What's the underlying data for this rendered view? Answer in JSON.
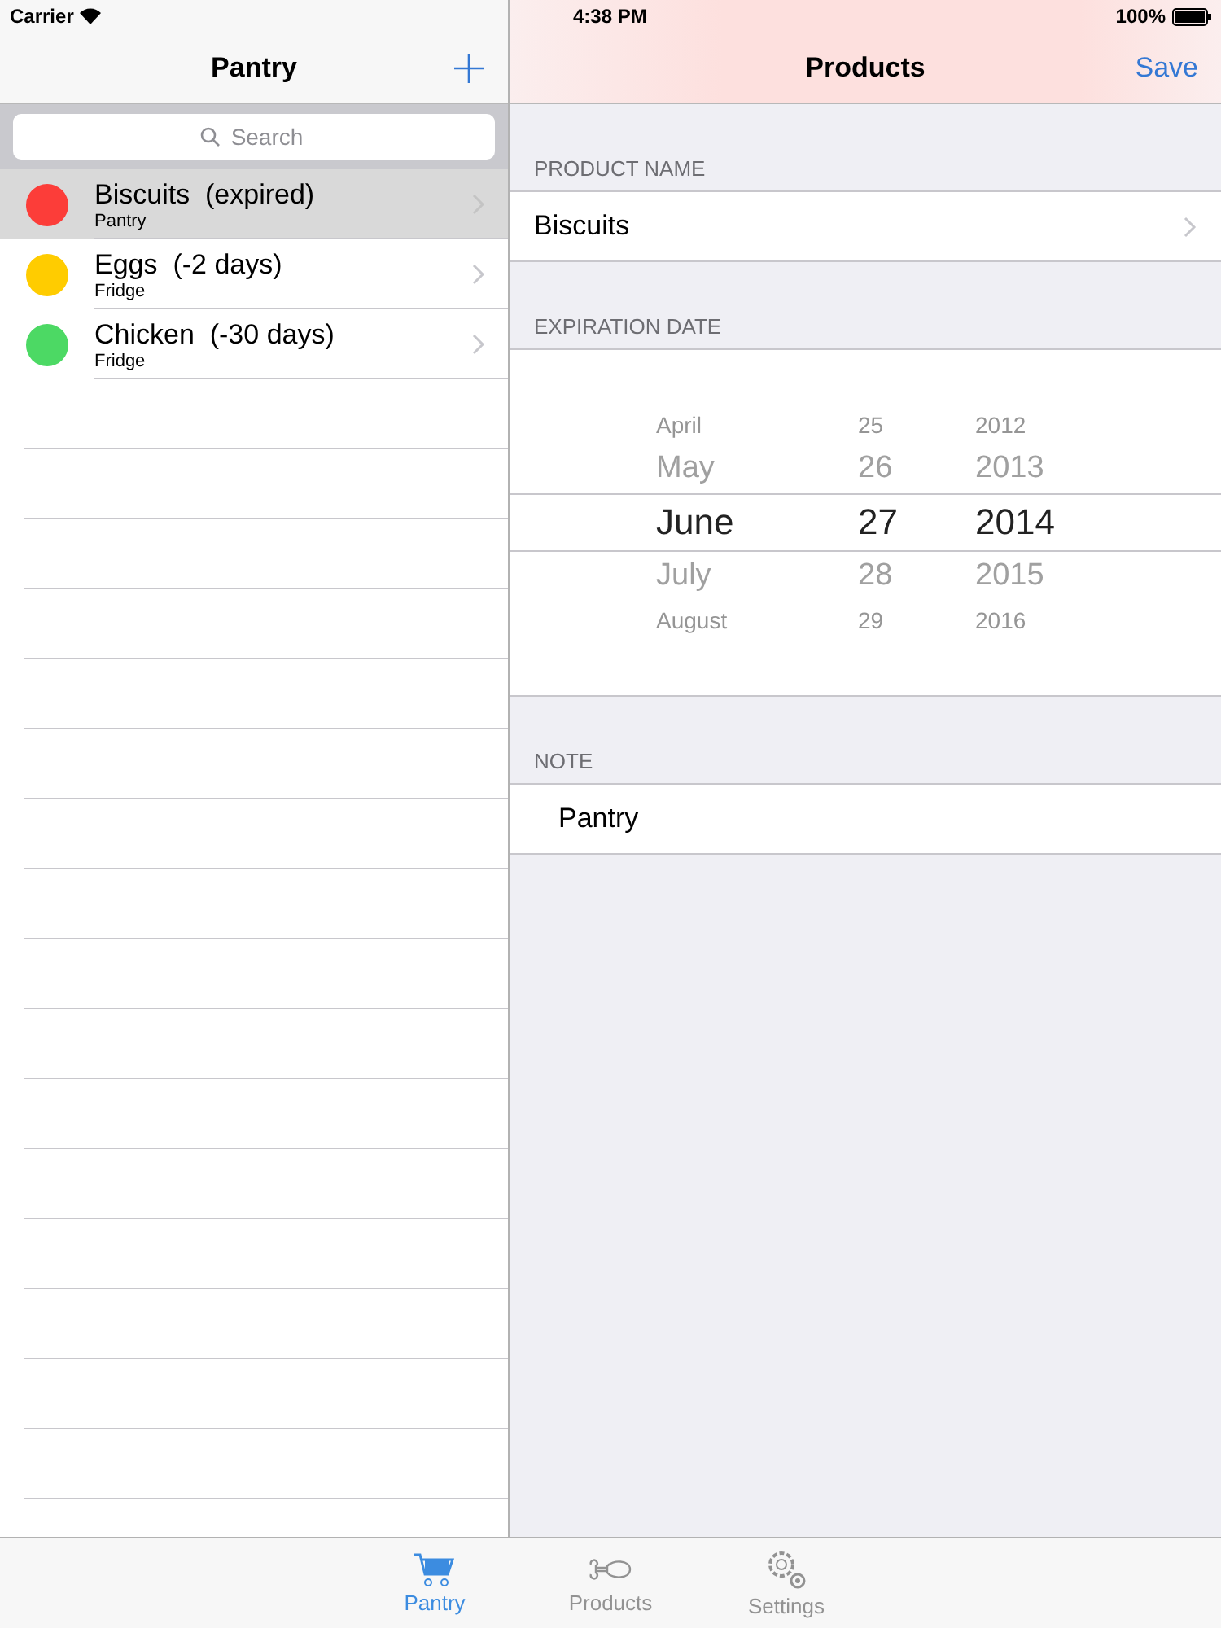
{
  "status_bar": {
    "carrier": "Carrier",
    "time": "4:38 PM",
    "battery": "100%"
  },
  "master": {
    "title": "Pantry",
    "search": {
      "placeholder": "Search"
    },
    "items": [
      {
        "name": "Biscuits  (expired)",
        "location": "Pantry",
        "color": "#fc3d39",
        "selected": true
      },
      {
        "name": "Eggs  (-2 days)",
        "location": "Fridge",
        "color": "#ffcc00",
        "selected": false
      },
      {
        "name": "Chicken  (-30 days)",
        "location": "Fridge",
        "color": "#4cd964",
        "selected": false
      }
    ]
  },
  "detail": {
    "title": "Products",
    "save": "Save",
    "product_name": {
      "header": "PRODUCT NAME",
      "value": "Biscuits"
    },
    "expiration_date": {
      "header": "EXPIRATION DATE",
      "rows": [
        {
          "month": "April",
          "day": "25",
          "year": "2012",
          "selected": false
        },
        {
          "month": "May",
          "day": "26",
          "year": "2013",
          "selected": false
        },
        {
          "month": "June",
          "day": "27",
          "year": "2014",
          "selected": true
        },
        {
          "month": "July",
          "day": "28",
          "year": "2015",
          "selected": false
        },
        {
          "month": "August",
          "day": "29",
          "year": "2016",
          "selected": false
        }
      ]
    },
    "note": {
      "header": "NOTE",
      "value": "Pantry"
    }
  },
  "tab_bar": [
    {
      "label": "Pantry",
      "kind": "cart",
      "selected": true
    },
    {
      "label": "Products",
      "kind": "bone",
      "selected": false
    },
    {
      "label": "Settings",
      "kind": "gears",
      "selected": false
    }
  ]
}
